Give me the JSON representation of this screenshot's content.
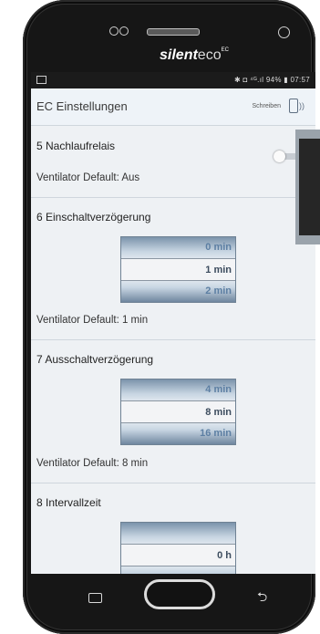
{
  "brand": {
    "name": "silent",
    "suffix": "eco",
    "sup": "EC"
  },
  "statusbar": {
    "right_text": "✱ ◘ ⁴ᴳ.ıl 94% ▮ 07:57"
  },
  "header": {
    "title": "EC Einstellungen",
    "write_label": "Schreiben",
    "write_icon": "device-signal-icon"
  },
  "sections": {
    "s5": {
      "title": "5  Nachlaufrelais",
      "default": "Ventilator Default: Aus",
      "toggle_on": false
    },
    "s6": {
      "title": "6  Einschaltverzögerung",
      "options": [
        "0 min",
        "1 min",
        "2 min"
      ],
      "selected": "1 min",
      "default": "Ventilator Default: 1 min"
    },
    "s7": {
      "title": "7  Ausschaltverzögerung",
      "options": [
        "4 min",
        "8 min",
        "16 min"
      ],
      "selected": "8 min",
      "default": "Ventilator Default: 8 min"
    },
    "s8": {
      "title": "8  Intervallzeit",
      "options": [
        "",
        "0 h"
      ],
      "selected": "0 h"
    }
  },
  "navbar": {
    "recents_icon": "recents-icon",
    "home": "home-button",
    "back_icon": "back-icon"
  },
  "colors": {
    "screen_bg": "#eef1f4",
    "picker_text": "#5d7fa3",
    "picker_selected_text": "#3c4c5e",
    "phone": "#161616"
  }
}
